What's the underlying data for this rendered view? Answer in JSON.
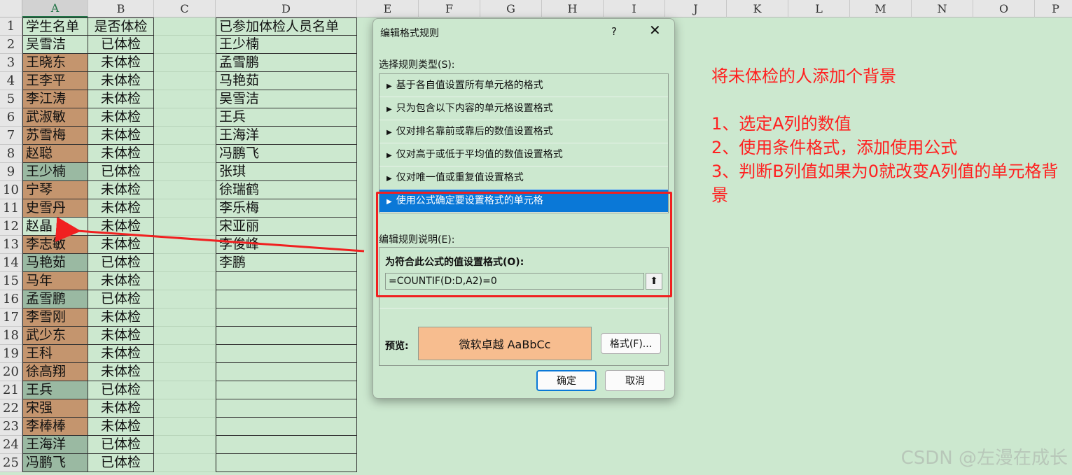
{
  "columns": [
    "A",
    "B",
    "C",
    "D",
    "E",
    "F",
    "G",
    "H",
    "I",
    "J",
    "K",
    "L",
    "M",
    "N",
    "O",
    "P"
  ],
  "rows": [
    {
      "n": "1",
      "a": "学生名单",
      "b": "是否体检",
      "d": "已参加体检人员名单",
      "a_fill": "none"
    },
    {
      "n": "2",
      "a": "吴雪洁",
      "b": "已体检",
      "d": "王少楠",
      "a_fill": "none"
    },
    {
      "n": "3",
      "a": "王晓东",
      "b": "未体检",
      "d": "孟雪鹏",
      "a_fill": "orange"
    },
    {
      "n": "4",
      "a": "王李平",
      "b": "未体检",
      "d": "马艳茹",
      "a_fill": "orange"
    },
    {
      "n": "5",
      "a": "李江涛",
      "b": "未体检",
      "d": "吴雪洁",
      "a_fill": "orange"
    },
    {
      "n": "6",
      "a": "武淑敏",
      "b": "未体检",
      "d": "王兵",
      "a_fill": "orange"
    },
    {
      "n": "7",
      "a": "苏雪梅",
      "b": "未体检",
      "d": "王海洋",
      "a_fill": "orange"
    },
    {
      "n": "8",
      "a": "赵聪",
      "b": "未体检",
      "d": "冯鹏飞",
      "a_fill": "orange"
    },
    {
      "n": "9",
      "a": "王少楠",
      "b": "已体检",
      "d": "张琪",
      "a_fill": "gray"
    },
    {
      "n": "10",
      "a": "宁琴",
      "b": "未体检",
      "d": "徐瑞鹤",
      "a_fill": "orange"
    },
    {
      "n": "11",
      "a": "史雪丹",
      "b": "未体检",
      "d": "李乐梅",
      "a_fill": "orange"
    },
    {
      "n": "12",
      "a": "赵晶",
      "b": "未体检",
      "d": "宋亚丽",
      "a_fill": "none"
    },
    {
      "n": "13",
      "a": "李志敏",
      "b": "未体检",
      "d": "李俊峰",
      "a_fill": "orange"
    },
    {
      "n": "14",
      "a": "马艳茹",
      "b": "已体检",
      "d": "李鹏",
      "a_fill": "gray"
    },
    {
      "n": "15",
      "a": "马年",
      "b": "未体检",
      "d": "",
      "a_fill": "orange"
    },
    {
      "n": "16",
      "a": "孟雪鹏",
      "b": "已体检",
      "d": "",
      "a_fill": "gray"
    },
    {
      "n": "17",
      "a": "李雪刚",
      "b": "未体检",
      "d": "",
      "a_fill": "orange"
    },
    {
      "n": "18",
      "a": "武少东",
      "b": "未体检",
      "d": "",
      "a_fill": "orange"
    },
    {
      "n": "19",
      "a": "王科",
      "b": "未体检",
      "d": "",
      "a_fill": "orange"
    },
    {
      "n": "20",
      "a": "徐高翔",
      "b": "未体检",
      "d": "",
      "a_fill": "orange"
    },
    {
      "n": "21",
      "a": "王兵",
      "b": "已体检",
      "d": "",
      "a_fill": "gray"
    },
    {
      "n": "22",
      "a": "宋强",
      "b": "未体检",
      "d": "",
      "a_fill": "orange"
    },
    {
      "n": "23",
      "a": "李棒棒",
      "b": "未体检",
      "d": "",
      "a_fill": "orange"
    },
    {
      "n": "24",
      "a": "王海洋",
      "b": "已体检",
      "d": "",
      "a_fill": "gray"
    },
    {
      "n": "25",
      "a": "冯鹏飞",
      "b": "已体检",
      "d": "",
      "a_fill": "gray"
    }
  ],
  "note": {
    "line1": "将未体检的人添加个背景",
    "line2": "1、选定A列的数值",
    "line3": "2、使用条件格式，添加使用公式",
    "line4": "3、判断B列值如果为0就改变A列值的单元格背景"
  },
  "watermark": "CSDN @左漫在成长",
  "dialog": {
    "title": "编辑格式规则",
    "help": "?",
    "close": "✕",
    "rule_type_label": "选择规则类型(S):",
    "rule_types": [
      "基于各自值设置所有单元格的格式",
      "只为包含以下内容的单元格设置格式",
      "仅对排名靠前或靠后的数值设置格式",
      "仅对高于或低于平均值的数值设置格式",
      "仅对唯一值或重复值设置格式",
      "使用公式确定要设置格式的单元格"
    ],
    "selected_rule_index": 5,
    "desc_label": "编辑规则说明(E):",
    "formula_label": "为符合此公式的值设置格式(O):",
    "formula_value": "=COUNTIF(D:D,A2)=0",
    "collapse_icon": "⬆",
    "preview_label": "预览:",
    "preview_text": "微软卓越  AaBbCc",
    "preview_bg": "#f7bd8f",
    "format_button": "格式(F)...",
    "ok_button": "确定",
    "cancel_button": "取消"
  },
  "colors": {
    "sheet_bg": "#cce8cf",
    "orange_fill": "#c4956e",
    "gray_fill": "#9ab9a2",
    "selected_rule": "#0a78d7",
    "annotation": "#ff2020"
  }
}
